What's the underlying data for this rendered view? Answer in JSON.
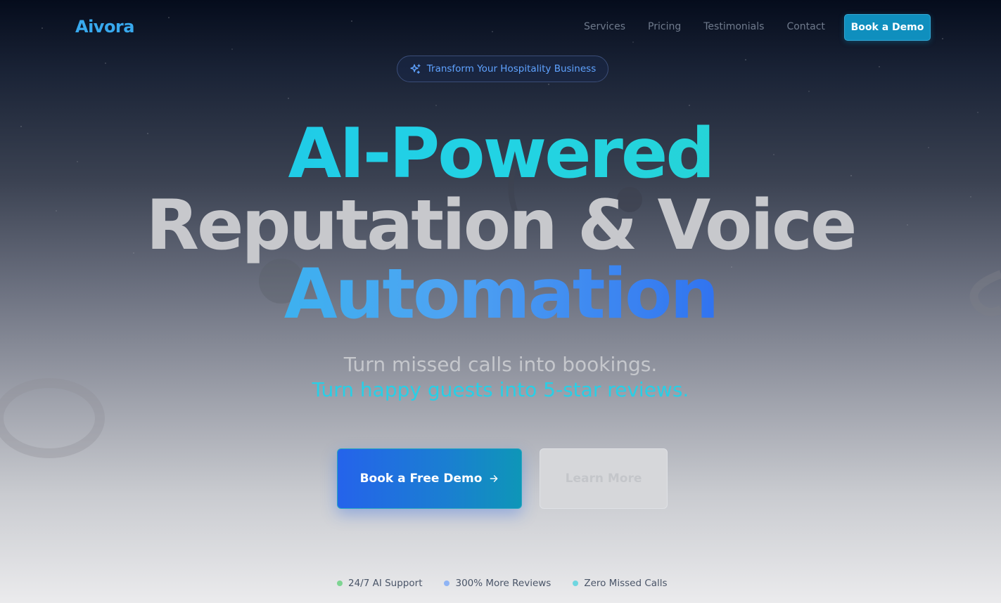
{
  "brand": {
    "name": "Aivora"
  },
  "nav": {
    "links": [
      "Services",
      "Pricing",
      "Testimonials",
      "Contact"
    ],
    "cta_label": "Book a Demo"
  },
  "badge": {
    "icon": "sparkles-icon",
    "text": "Transform Your Hospitality Business"
  },
  "hero": {
    "line1": "AI-Powered",
    "line2": "Reputation & Voice",
    "line3": "Automation",
    "subtitle1": "Turn missed calls into bookings.",
    "subtitle2": "Turn happy guests into 5-star reviews."
  },
  "buttons": {
    "primary_label": "Book a Free Demo",
    "primary_icon": "arrow-right-icon",
    "secondary_label": "Learn More"
  },
  "stats": [
    {
      "label": "24/7 AI Support",
      "color": "#7ed492"
    },
    {
      "label": "300% More Reviews",
      "color": "#8fb4f5"
    },
    {
      "label": "Zero Missed Calls",
      "color": "#6fd6e0"
    }
  ],
  "colors": {
    "brand": "#38a9ee",
    "accent_cyan": "#22d3e4",
    "accent_blue": "#2563eb",
    "nav_cta": "#0f8fbe"
  }
}
